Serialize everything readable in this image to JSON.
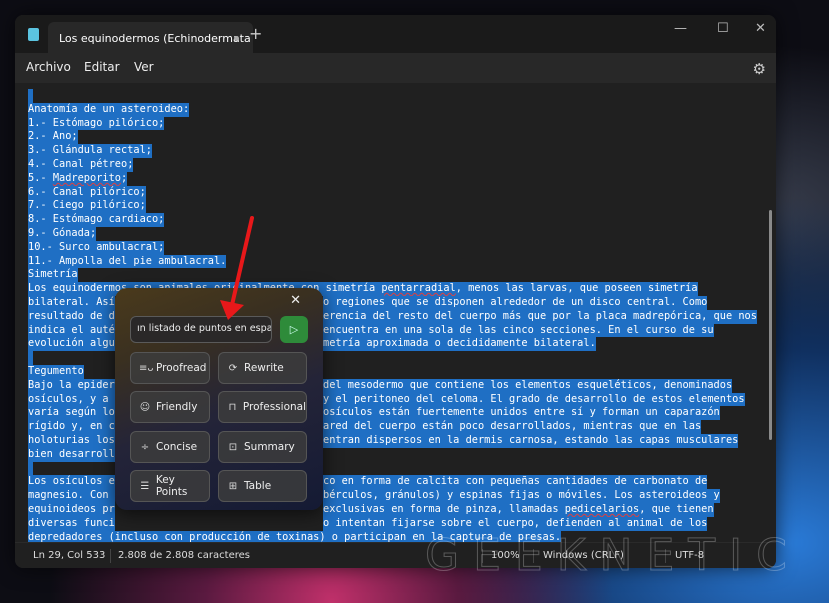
{
  "window": {
    "tab_title": "Los equinodermos (Echinodermata",
    "tab_modified": true,
    "new_tab": "+",
    "controls": [
      "—",
      "☐",
      "✕"
    ]
  },
  "menu": {
    "items": [
      "Archivo",
      "Editar",
      "Ver"
    ],
    "settings_icon": "gear-icon"
  },
  "editor": {
    "selection_color": "#1f6fc4",
    "lines": [
      [
        ""
      ],
      [
        "Anatomía de un asteroideo:"
      ],
      [
        "1.- Estómago pilórico;"
      ],
      [
        "2.- Ano;"
      ],
      [
        "3.- Glándula rectal;"
      ],
      [
        "4.- Canal pétreo;"
      ],
      [
        "5.- Madreporito;"
      ],
      [
        "6.- Canal pilórico;"
      ],
      [
        "7.- Ciego pilórico;"
      ],
      [
        "8.- Estómago cardiaco;"
      ],
      [
        "9.- Gónada;"
      ],
      [
        "10.- Surco ambulacral;"
      ],
      [
        "11.- Ampolla del pie ambulacral."
      ],
      [
        "Simetría"
      ],
      [
        "Los equinodermos son animales originalmente con simetría pentarradial, menos las larvas, que poseen simetría"
      ],
      [
        "bilateral. Así",
        "o regiones que se disponen alrededor de un disco central. Como"
      ],
      [
        "resultado de d",
        "erencia del resto del cuerpo más que por la placa madrepórica, que nos"
      ],
      [
        "indica el auté",
        "encuentra en una sola de las cinco secciones. En el curso de su"
      ],
      [
        "evolución algu",
        "metría aproximada o decididamente bilateral."
      ],
      [
        ""
      ],
      [
        "Tegumento"
      ],
      [
        "Bajo la epider",
        "del mesodermo que contiene los elementos esqueléticos, denominados"
      ],
      [
        "osículos, y a ",
        "y el peritoneo del celoma. El grado de desarrollo de estos elementos"
      ],
      [
        "varía según lo",
        "osículos están fuertemente unidos entre sí y forman un caparazón"
      ],
      [
        "rígido y, en c",
        "ared del cuerpo están poco desarrollados, mientras que en las"
      ],
      [
        "holoturias los",
        "entran dispersos en la dermis carnosa, estando las capas musculares"
      ],
      [
        "bien desarroll"
      ],
      [
        ""
      ],
      [
        "Los osículos e",
        "co en forma de calcita con pequeñas cantidades de carbonato de"
      ],
      [
        "magnesio. Con ",
        "bérculos, gránulos) y espinas fijas o móviles. Los asteroideos y"
      ],
      [
        "equinoideos pr",
        "exclusivas en forma de pinza, llamadas pedicelarios, que tienen"
      ],
      [
        "diversas funci",
        "o intentan fijarse sobre el cuerpo, defienden al animal de los"
      ],
      [
        "depredadores (incluso con producción de toxinas) o participan en la captura de presas."
      ]
    ]
  },
  "status": {
    "position": "Ln 29, Col 533",
    "chars": "2.808 de 2.808 caracteres",
    "zoom": "100%",
    "line_ending": "Windows (CRLF)",
    "encoding": "UTF-8"
  },
  "watermark": "GEEKNETIC",
  "popup": {
    "close": "✕",
    "input_value": "ın listado de puntos en español",
    "send_icon": "send-icon",
    "accent": "#2e8b3a",
    "buttons": [
      {
        "label": "Proofread",
        "icon": "proofread-icon",
        "glyph": "≡ᴗ"
      },
      {
        "label": "Rewrite",
        "icon": "rewrite-icon",
        "glyph": "⟳"
      },
      {
        "label": "Friendly",
        "icon": "smile-icon",
        "glyph": "☺"
      },
      {
        "label": "Professional",
        "icon": "briefcase-icon",
        "glyph": "⊓"
      },
      {
        "label": "Concise",
        "icon": "concise-icon",
        "glyph": "÷"
      },
      {
        "label": "Summary",
        "icon": "summary-icon",
        "glyph": "⊡"
      },
      {
        "label": "Key Points",
        "icon": "list-icon",
        "glyph": "☰"
      },
      {
        "label": "Table",
        "icon": "table-icon",
        "glyph": "⊞"
      }
    ]
  },
  "annotation": {
    "arrow_color": "#e8181a"
  }
}
